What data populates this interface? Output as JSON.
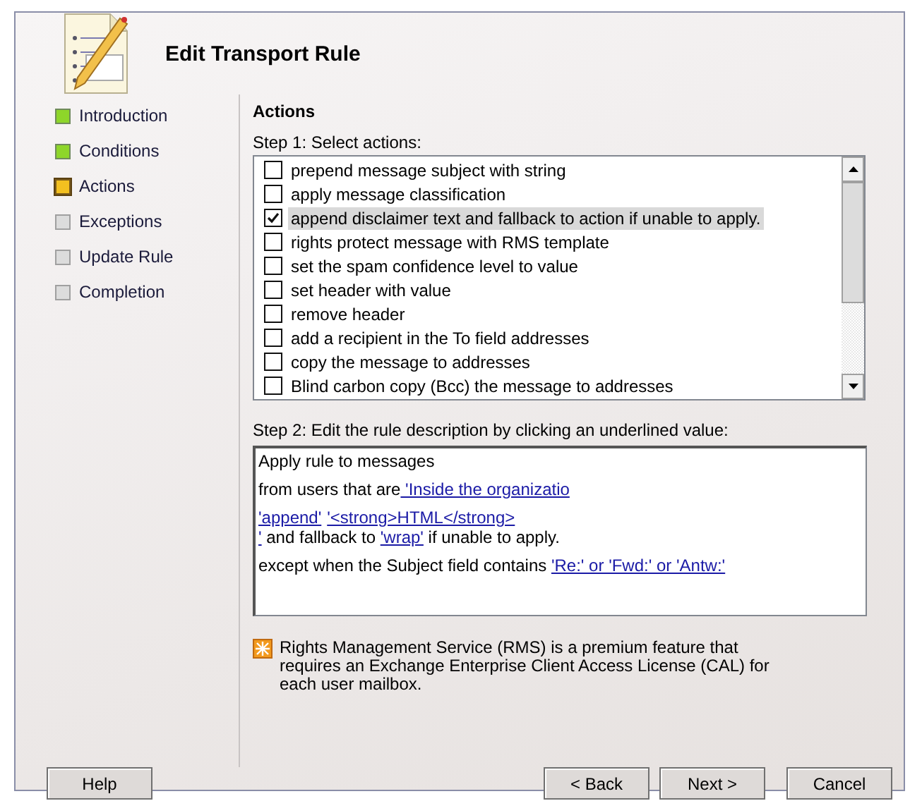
{
  "dialog": {
    "title": "Edit Transport Rule",
    "steps": [
      {
        "label": "Introduction",
        "kind": "done",
        "selected": false
      },
      {
        "label": "Conditions",
        "kind": "done",
        "selected": false
      },
      {
        "label": "Actions",
        "kind": "current",
        "selected": true
      },
      {
        "label": "Exceptions",
        "kind": "pending",
        "selected": false
      },
      {
        "label": "Update Rule",
        "kind": "pending",
        "selected": false
      },
      {
        "label": "Completion",
        "kind": "pending",
        "selected": false
      }
    ],
    "section_title": "Actions",
    "step1_label": "Step 1: Select actions:",
    "actions": [
      {
        "label": "prepend message subject with string",
        "checked": false,
        "selected": false
      },
      {
        "label": "apply message classification",
        "checked": false,
        "selected": false
      },
      {
        "label": "append disclaimer text and fallback to action if unable to apply.",
        "checked": true,
        "selected": true
      },
      {
        "label": "rights protect message with RMS template",
        "checked": false,
        "selected": false
      },
      {
        "label": "set the spam confidence level to value",
        "checked": false,
        "selected": false
      },
      {
        "label": "set header with value",
        "checked": false,
        "selected": false
      },
      {
        "label": "remove header",
        "checked": false,
        "selected": false
      },
      {
        "label": "add a recipient in the To field addresses",
        "checked": false,
        "selected": false
      },
      {
        "label": "copy the message to addresses",
        "checked": false,
        "selected": false
      },
      {
        "label": "Blind carbon copy (Bcc) the message to addresses",
        "checked": false,
        "selected": false
      }
    ],
    "step2_label": "Step 2: Edit the rule description by clicking an underlined value:",
    "description": [
      {
        "kind": "paragraph",
        "segments": [
          {
            "text": "Apply rule to messages",
            "kind": "text"
          }
        ]
      },
      {
        "kind": "paragraph",
        "segments": [
          {
            "text": "from users that are",
            "kind": "text"
          },
          {
            "text": " 'Inside the organizatio",
            "kind": "link"
          }
        ]
      },
      {
        "kind": "paragraph",
        "segments": [
          {
            "text": "'append'",
            "kind": "link"
          },
          {
            "text": "'<strong>HTML</strong>",
            "kind": "link"
          }
        ]
      },
      {
        "kind": "continuation",
        "segments": [
          {
            "text": "'",
            "kind": "link"
          },
          {
            "text": " and fallback to ",
            "kind": "text"
          },
          {
            "text": "'wrap'",
            "kind": "link"
          },
          {
            "text": " if unable to apply.",
            "kind": "text"
          }
        ]
      },
      {
        "kind": "paragraph",
        "segments": [
          {
            "text": "except when the Subject field contains ",
            "kind": "text"
          },
          {
            "text": "'Re:' or 'Fwd:' or 'Antw:'",
            "kind": "link"
          }
        ]
      }
    ],
    "notice": "Rights Management Service (RMS) is a premium feature that requires an Exchange Enterprise Client Access License (CAL) for each user mailbox.",
    "buttons": [
      {
        "label": "Help",
        "kind": "help"
      },
      {
        "label": "< Back",
        "kind": "nav"
      },
      {
        "label": "Next >",
        "kind": "nav"
      },
      {
        "label": "Cancel",
        "kind": "cancel"
      }
    ]
  }
}
